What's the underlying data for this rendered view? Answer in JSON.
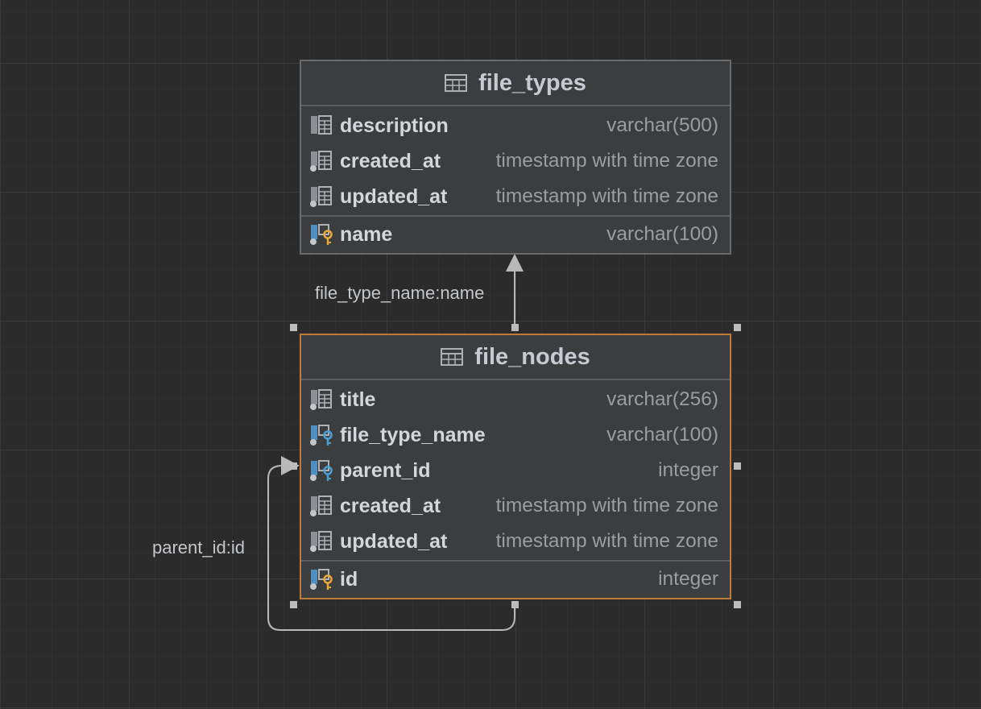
{
  "tables": [
    {
      "name": "file_types",
      "icon": "table-icon",
      "columns": [
        {
          "name": "description",
          "type": "varchar(500)",
          "icon": "column-icon"
        },
        {
          "name": "created_at",
          "type": "timestamp with time zone",
          "icon": "column-not-null-icon"
        },
        {
          "name": "updated_at",
          "type": "timestamp with time zone",
          "icon": "column-not-null-icon"
        }
      ],
      "keys": [
        {
          "name": "name",
          "type": "varchar(100)",
          "icon": "primary-key-icon"
        }
      ]
    },
    {
      "name": "file_nodes",
      "icon": "table-icon",
      "selected": true,
      "columns": [
        {
          "name": "title",
          "type": "varchar(256)",
          "icon": "column-not-null-icon"
        },
        {
          "name": "file_type_name",
          "type": "varchar(100)",
          "icon": "foreign-key-icon"
        },
        {
          "name": "parent_id",
          "type": "integer",
          "icon": "foreign-key-icon"
        },
        {
          "name": "created_at",
          "type": "timestamp with time zone",
          "icon": "column-not-null-icon"
        },
        {
          "name": "updated_at",
          "type": "timestamp with time zone",
          "icon": "column-not-null-icon"
        }
      ],
      "keys": [
        {
          "name": "id",
          "type": "integer",
          "icon": "primary-key-icon"
        }
      ]
    }
  ],
  "relations": [
    {
      "label": "file_type_name:name",
      "from": "file_nodes",
      "to": "file_types"
    },
    {
      "label": "parent_id:id",
      "from": "file_nodes",
      "to": "file_nodes"
    }
  ],
  "colors": {
    "background": "#2b2b2b",
    "table_fill": "#3b3d3f",
    "selected_border": "#c07b36",
    "primary_key": "#e5a83b",
    "foreign_key": "#4a9fd4",
    "edge": "#b9b9b9"
  }
}
